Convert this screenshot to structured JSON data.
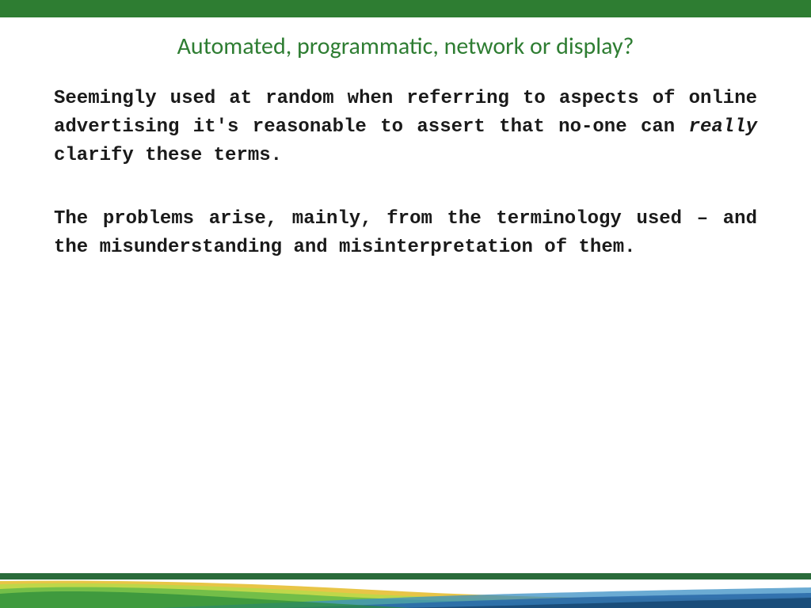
{
  "slide": {
    "title": "Automated, programmatic, network or display?",
    "paragraph1_before": "Seemingly used at random when referring to aspects of online advertising it's reasonable to assert that no-one can ",
    "paragraph1_emphasis": "really",
    "paragraph1_after": " clarify these terms.",
    "paragraph2": "The problems arise, mainly, from the terminology used – and the misunderstanding and misinterpretation of them."
  },
  "colors": {
    "header_bar": "#2e7d32",
    "title_text": "#2e7d32",
    "body_text": "#1a1a1a"
  }
}
